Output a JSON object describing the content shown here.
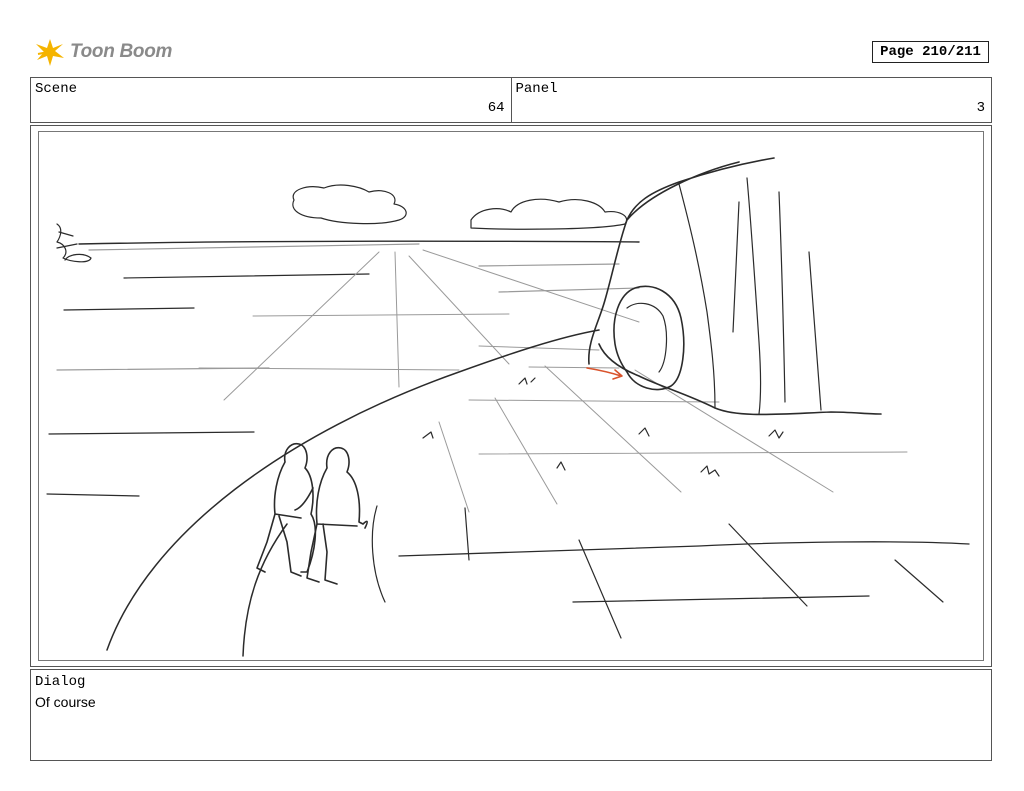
{
  "header": {
    "logo_text": "Toon Boom",
    "page_indicator": "Page 210/211"
  },
  "info": {
    "scene_label": "Scene",
    "scene_value": "64",
    "panel_label": "Panel",
    "panel_value": "3"
  },
  "dialog": {
    "label": "Dialog",
    "text": "Of course"
  },
  "colors": {
    "sketch_line": "#2b2b2b",
    "guide_line": "#9a9a9a",
    "arrow": "#d9532c",
    "logo_yellow": "#f5b400"
  }
}
